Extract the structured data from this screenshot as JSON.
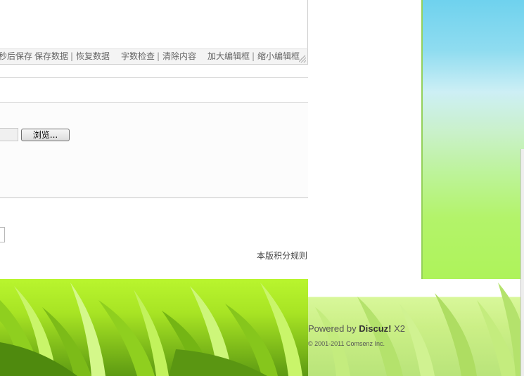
{
  "editor": {
    "toolbar": {
      "autosave": "秒后保存",
      "save_data": "保存数据",
      "restore_data": "恢复数据",
      "word_check": "字数检查",
      "clear_content": "清除内容",
      "enlarge_editor": "加大编辑框",
      "shrink_editor": "缩小编辑框",
      "separator": "|"
    }
  },
  "attachment": {
    "browse_label": "浏览..."
  },
  "links": {
    "credit_rules": "本版积分规则"
  },
  "footer": {
    "powered_prefix": "Powered by ",
    "powered_brand": "Discuz!",
    "powered_version": " X2",
    "copyright": "© 2001-2011 Comsenz Inc."
  },
  "colors": {
    "sky_top": "#6fd2ee",
    "grass": "#aef35a"
  }
}
